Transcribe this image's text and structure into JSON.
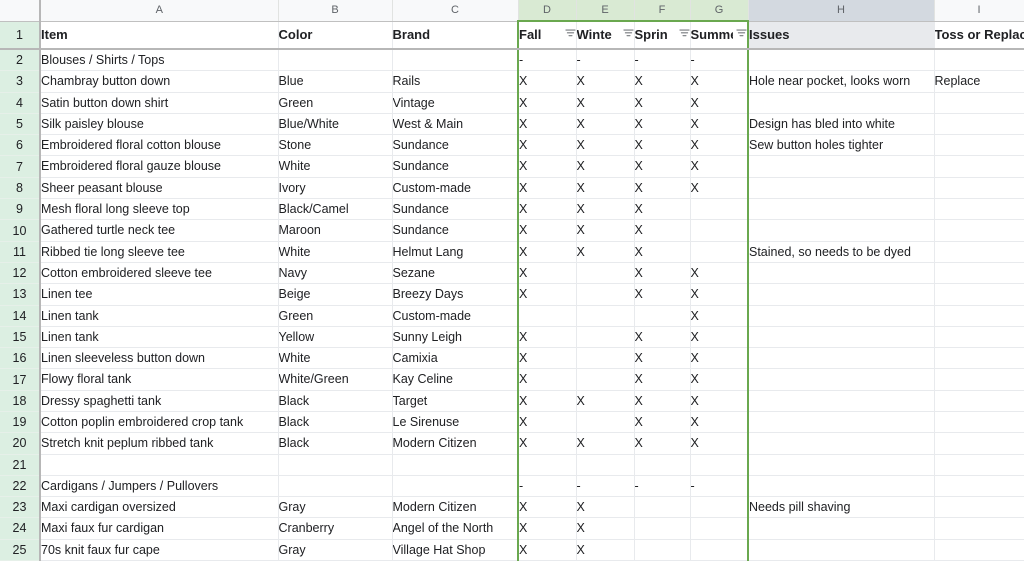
{
  "spreadsheet": {
    "column_letters": [
      "A",
      "B",
      "C",
      "D",
      "E",
      "F",
      "G",
      "H",
      "I"
    ],
    "filtered_columns": [
      "D",
      "E",
      "F",
      "G"
    ],
    "selected_column": "H",
    "colors": {
      "filter_header_bg": "#d9ead3",
      "filter_border": "#6aa84f",
      "selected_header_bg": "#d3d9e0",
      "rownum_bg": "#dcefe2",
      "grid_line": "#e8eaed",
      "text": "#202124",
      "header_text": "#5f6368"
    },
    "headers": {
      "A": "Item",
      "B": "Color",
      "C": "Brand",
      "D": "Fall",
      "E": "Winte",
      "F": "Sprin",
      "G": "Summe",
      "H": "Issues",
      "I": "Toss or Replace"
    },
    "filter_icon_name": "filter-funnel-icon",
    "rows": [
      {
        "n": "2",
        "item": "Blouses / Shirts / Tops",
        "bold": true,
        "color": "",
        "brand": "",
        "fall": "-",
        "winter": "-",
        "spring": "-",
        "summer": "-",
        "issues": "",
        "toss": ""
      },
      {
        "n": "3",
        "item": "Chambray button down",
        "bold": false,
        "color": "Blue",
        "brand": "Rails",
        "fall": "X",
        "winter": "X",
        "spring": "X",
        "summer": "X",
        "issues": "Hole near pocket, looks worn",
        "toss": "Replace"
      },
      {
        "n": "4",
        "item": "Satin button down shirt",
        "bold": false,
        "color": "Green",
        "brand": "Vintage",
        "fall": "X",
        "winter": "X",
        "spring": "X",
        "summer": "X",
        "issues": "",
        "toss": ""
      },
      {
        "n": "5",
        "item": "Silk paisley blouse",
        "bold": false,
        "color": "Blue/White",
        "brand": "West & Main",
        "fall": "X",
        "winter": "X",
        "spring": "X",
        "summer": "X",
        "issues": "Design has bled into white",
        "toss": ""
      },
      {
        "n": "6",
        "item": "Embroidered floral cotton blouse",
        "bold": false,
        "color": "Stone",
        "brand": "Sundance",
        "fall": "X",
        "winter": "X",
        "spring": "X",
        "summer": "X",
        "issues": "Sew button holes tighter",
        "toss": ""
      },
      {
        "n": "7",
        "item": "Embroidered floral gauze blouse",
        "bold": false,
        "color": "White",
        "brand": "Sundance",
        "fall": "X",
        "winter": "X",
        "spring": "X",
        "summer": "X",
        "issues": "",
        "toss": ""
      },
      {
        "n": "8",
        "item": "Sheer peasant blouse",
        "bold": false,
        "color": "Ivory",
        "brand": "Custom-made",
        "fall": "X",
        "winter": "X",
        "spring": "X",
        "summer": "X",
        "issues": "",
        "toss": ""
      },
      {
        "n": "9",
        "item": "Mesh floral long sleeve top",
        "bold": false,
        "color": "Black/Camel",
        "brand": "Sundance",
        "fall": "X",
        "winter": "X",
        "spring": "X",
        "summer": "",
        "issues": "",
        "toss": ""
      },
      {
        "n": "10",
        "item": "Gathered turtle neck tee",
        "bold": false,
        "color": "Maroon",
        "brand": "Sundance",
        "fall": "X",
        "winter": "X",
        "spring": "X",
        "summer": "",
        "issues": "",
        "toss": ""
      },
      {
        "n": "11",
        "item": "Ribbed tie long sleeve tee",
        "bold": false,
        "color": "White",
        "brand": "Helmut Lang",
        "fall": "X",
        "winter": "X",
        "spring": "X",
        "summer": "",
        "issues": "Stained, so needs to be dyed",
        "toss": ""
      },
      {
        "n": "12",
        "item": "Cotton embroidered sleeve tee",
        "bold": false,
        "color": "Navy",
        "brand": "Sezane",
        "fall": "X",
        "winter": "",
        "spring": "X",
        "summer": "X",
        "issues": "",
        "toss": ""
      },
      {
        "n": "13",
        "item": "Linen tee",
        "bold": false,
        "color": "Beige",
        "brand": "Breezy Days",
        "fall": "X",
        "winter": "",
        "spring": "X",
        "summer": "X",
        "issues": "",
        "toss": ""
      },
      {
        "n": "14",
        "item": "Linen tank",
        "bold": false,
        "color": "Green",
        "brand": "Custom-made",
        "fall": "",
        "winter": "",
        "spring": "",
        "summer": "X",
        "issues": "",
        "toss": ""
      },
      {
        "n": "15",
        "item": "Linen tank",
        "bold": false,
        "color": "Yellow",
        "brand": "Sunny Leigh",
        "fall": "X",
        "winter": "",
        "spring": "X",
        "summer": "X",
        "issues": "",
        "toss": ""
      },
      {
        "n": "16",
        "item": "Linen sleeveless button down",
        "bold": false,
        "color": "White",
        "brand": "Camixia",
        "fall": "X",
        "winter": "",
        "spring": "X",
        "summer": "X",
        "issues": "",
        "toss": ""
      },
      {
        "n": "17",
        "item": "Flowy floral tank",
        "bold": false,
        "color": "White/Green",
        "brand": "Kay Celine",
        "fall": "X",
        "winter": "",
        "spring": "X",
        "summer": "X",
        "issues": "",
        "toss": ""
      },
      {
        "n": "18",
        "item": "Dressy spaghetti tank",
        "bold": false,
        "color": "Black",
        "brand": "Target",
        "fall": "X",
        "winter": "X",
        "spring": "X",
        "summer": "X",
        "issues": "",
        "toss": ""
      },
      {
        "n": "19",
        "item": "Cotton poplin embroidered crop tank",
        "bold": false,
        "color": "Black",
        "brand": "Le Sirenuse",
        "fall": "X",
        "winter": "",
        "spring": "X",
        "summer": "X",
        "issues": "",
        "toss": ""
      },
      {
        "n": "20",
        "item": "Stretch knit peplum ribbed tank",
        "bold": false,
        "color": "Black",
        "brand": "Modern Citizen",
        "fall": "X",
        "winter": "X",
        "spring": "X",
        "summer": "X",
        "issues": "",
        "toss": ""
      },
      {
        "n": "21",
        "item": "",
        "bold": false,
        "color": "",
        "brand": "",
        "fall": "",
        "winter": "",
        "spring": "",
        "summer": "",
        "issues": "",
        "toss": ""
      },
      {
        "n": "22",
        "item": "Cardigans / Jumpers / Pullovers",
        "bold": true,
        "color": "",
        "brand": "",
        "fall": "-",
        "winter": "-",
        "spring": "-",
        "summer": "-",
        "issues": "",
        "toss": ""
      },
      {
        "n": "23",
        "item": "Maxi cardigan oversized",
        "bold": false,
        "color": "Gray",
        "brand": "Modern Citizen",
        "fall": "X",
        "winter": "X",
        "spring": "",
        "summer": "",
        "issues": "Needs pill shaving",
        "toss": ""
      },
      {
        "n": "24",
        "item": "Maxi faux fur cardigan",
        "bold": false,
        "color": "Cranberry",
        "brand": "Angel of the North",
        "fall": "X",
        "winter": "X",
        "spring": "",
        "summer": "",
        "issues": "",
        "toss": ""
      },
      {
        "n": "25",
        "item": "70s knit faux fur cape",
        "bold": false,
        "color": "Gray",
        "brand": "Village Hat Shop",
        "fall": "X",
        "winter": "X",
        "spring": "",
        "summer": "",
        "issues": "",
        "toss": ""
      }
    ]
  }
}
